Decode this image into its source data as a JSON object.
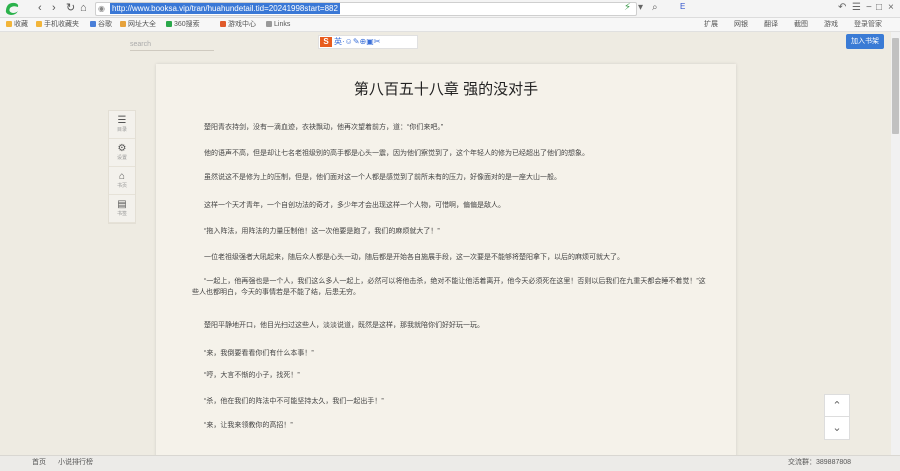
{
  "browser": {
    "url": "http://www.booksa.vip/tran/huahundetail.tid=20241998start=882",
    "profile_label": "E",
    "bookmarks": [
      {
        "label": "收藏",
        "color": "#f2b53a"
      },
      {
        "label": "手机收藏夹",
        "color": "#f2b53a"
      },
      {
        "label": "谷歌",
        "color": "#4a7fd8"
      },
      {
        "label": "网址大全",
        "color": "#e6a23c"
      },
      {
        "label": "360搜索",
        "color": "#2aa84a"
      },
      {
        "label": "游戏中心",
        "color": "#e05a2a"
      },
      {
        "label": "Links",
        "color": "#999999"
      }
    ],
    "bookbar_right": [
      "扩展",
      "网银",
      "翻译",
      "截图",
      "游戏",
      "登录管家"
    ]
  },
  "page": {
    "search_placeholder": "search",
    "translate_toolbar_label": "英·☺✎⊕▣✂",
    "add_shelf_button": "加入书架",
    "sidebar": [
      {
        "icon": "list-icon",
        "glyph": "☰",
        "label": "目录"
      },
      {
        "icon": "gear-icon",
        "glyph": "⚙",
        "label": "设置"
      },
      {
        "icon": "home-icon",
        "glyph": "⌂",
        "label": "书页"
      },
      {
        "icon": "bookmark-icon",
        "glyph": "▤",
        "label": "书签"
      }
    ],
    "chapter_title": "第八百五十八章 强的没对手",
    "paragraphs": [
      "楚阳青衣持剑，没有一滴血迹，衣袂飘动，他再次望着前方，道：“你们来吧。”",
      "他的语声不高，但是却让七名老祖级别的高手都是心头一震，因为他们察觉到了，这个年轻人的修为已经超出了他们的想象。",
      "虽然说这不是修为上的压制，但是，他们面对这一个人都是感觉到了前所未有的压力，好像面对的是一座大山一般。",
      "这样一个天才青年，一个自创功法的奇才，多少年才会出现这样一个人物，可惜啊，偏偏是敌人。",
      "“拖入阵法，用阵法的力量压制他！这一次他要是跑了，我们的麻烦就大了！”",
      "一位老祖级强者大吼起来，随后众人都是心头一动，随后都是开始各自施展手段，这一次要是不能够将楚阳拿下，以后的麻烦可就大了。",
      "“一起上，他再强也是一个人，我们这么多人一起上，必然可以将他击杀，绝对不能让他活着离开，他今天必须死在这里！否则以后我们在九重天都会睡不着觉！”这些人也都明白，今天的事情若是不能了结，后患无穷。",
      "楚阳平静地开口，他目光扫过这些人，淡淡说道，既然是这样，那我就陪你们好好玩一玩。",
      "“来，我倒要看看你们有什么本事！”",
      "“哼，大言不惭的小子，找死！”",
      "“杀，他在我们的阵法中不可能坚持太久，我们一起出手！”",
      "“来，让我来领教你的高招！”"
    ],
    "footer_left": [
      "首页",
      "小说排行榜"
    ],
    "footer_right": "交流群：389887808"
  }
}
